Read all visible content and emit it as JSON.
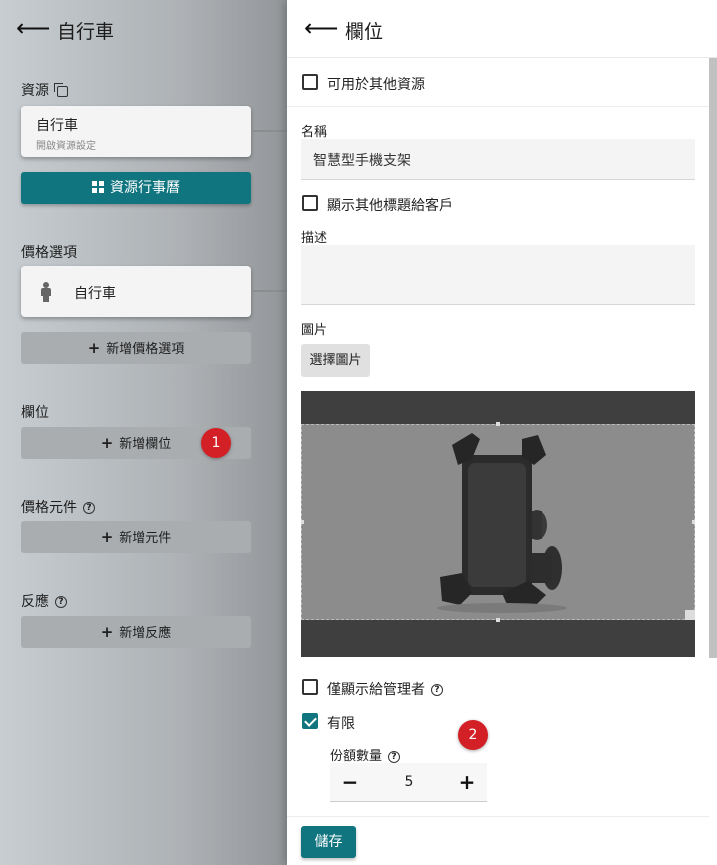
{
  "left": {
    "title": "自行車",
    "resources_label": "資源",
    "resource_card": {
      "title": "自行車",
      "subtitle": "開啟資源設定"
    },
    "calendar_button": "資源行事曆",
    "price_options_label": "價格選項",
    "price_card_title": "自行車",
    "add_price_option": "新增價格選項",
    "slots_label": "欄位",
    "add_slot": "新增欄位",
    "price_components_label": "價格元件",
    "add_component": "新增元件",
    "reactions_label": "反應",
    "add_reaction": "新增反應"
  },
  "badges": {
    "one": "1",
    "two": "2"
  },
  "drawer": {
    "title": "欄位",
    "available_other_resources": "可用於其他資源",
    "name_label": "名稱",
    "name_value": "智慧型手機支架",
    "show_other_titles": "顯示其他標題給客戶",
    "description_label": "描述",
    "image_label": "圖片",
    "choose_image": "選擇圖片",
    "admin_only": "僅顯示給管理者",
    "limited": "有限",
    "quota_label": "份額數量",
    "quota_value": "5",
    "save": "儲存"
  },
  "colors": {
    "accent": "#117580",
    "badge": "#d32027"
  },
  "icons": [
    "back-arrow-icon",
    "copy-icon",
    "grid-icon",
    "person-icon",
    "plus-icon",
    "help-icon",
    "minus-icon",
    "check-icon"
  ]
}
